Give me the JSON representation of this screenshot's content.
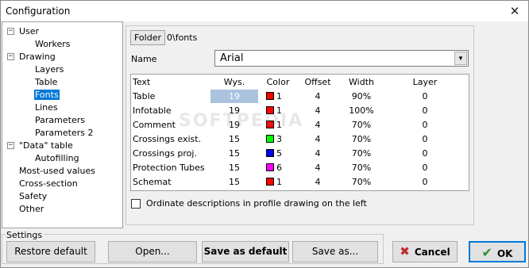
{
  "window": {
    "title": "Configuration",
    "close_glyph": "✕"
  },
  "tree": {
    "items": [
      {
        "label": "User",
        "expander": "−"
      },
      {
        "label": "Workers"
      },
      {
        "label": "Drawing",
        "expander": "−"
      },
      {
        "label": "Layers"
      },
      {
        "label": "Table"
      },
      {
        "label": "Fonts",
        "selected": true
      },
      {
        "label": "Lines"
      },
      {
        "label": "Parameters"
      },
      {
        "label": "Parameters 2"
      },
      {
        "label": "\"Data\" table",
        "expander": "−"
      },
      {
        "label": "Autofilling"
      },
      {
        "label": "Most-used values"
      },
      {
        "label": "Cross-section"
      },
      {
        "label": "Safety"
      },
      {
        "label": "Other"
      }
    ]
  },
  "fonts": {
    "folder_button": "Folder",
    "folder_path": "0\\fonts",
    "name_label": "Name",
    "name_value": "Arial",
    "dropdown_arrow": "▼",
    "columns": [
      "Text",
      "Wys.",
      "Color",
      "Offset",
      "Width",
      "Layer"
    ],
    "rows": [
      {
        "text": "Table",
        "wys": "19",
        "color": "#ff0000",
        "color_num": "1",
        "offset": "4",
        "width": "90%",
        "layer": "0"
      },
      {
        "text": "Infotable",
        "wys": "19",
        "color": "#ff0000",
        "color_num": "1",
        "offset": "4",
        "width": "100%",
        "layer": "0"
      },
      {
        "text": "Comment",
        "wys": "19",
        "color": "#ff0000",
        "color_num": "1",
        "offset": "4",
        "width": "70%",
        "layer": "0"
      },
      {
        "text": "Crossings exist.",
        "wys": "15",
        "color": "#00ff00",
        "color_num": "3",
        "offset": "4",
        "width": "70%",
        "layer": "0"
      },
      {
        "text": "Crossings proj.",
        "wys": "15",
        "color": "#0000ff",
        "color_num": "5",
        "offset": "4",
        "width": "70%",
        "layer": "0"
      },
      {
        "text": "Protection Tubes",
        "wys": "15",
        "color": "#ff00ff",
        "color_num": "6",
        "offset": "4",
        "width": "70%",
        "layer": "0"
      },
      {
        "text": "Schemat",
        "wys": "15",
        "color": "#ff0000",
        "color_num": "1",
        "offset": "4",
        "width": "70%",
        "layer": "0"
      }
    ],
    "checkbox_label": "Ordinate descriptions in profile drawing on the left",
    "checkbox_checked": false
  },
  "watermark": "SOFTPEDIA",
  "settings": {
    "group_label": "Settings",
    "restore_default": "Restore default",
    "open": "Open...",
    "save_as_default": "Save as default",
    "save_as": "Save as..."
  },
  "dialog": {
    "cancel": "Cancel",
    "cancel_icon": "✖",
    "cancel_color": "#c0282d",
    "ok": "OK",
    "ok_icon": "✔",
    "ok_color": "#2e8b2e"
  }
}
